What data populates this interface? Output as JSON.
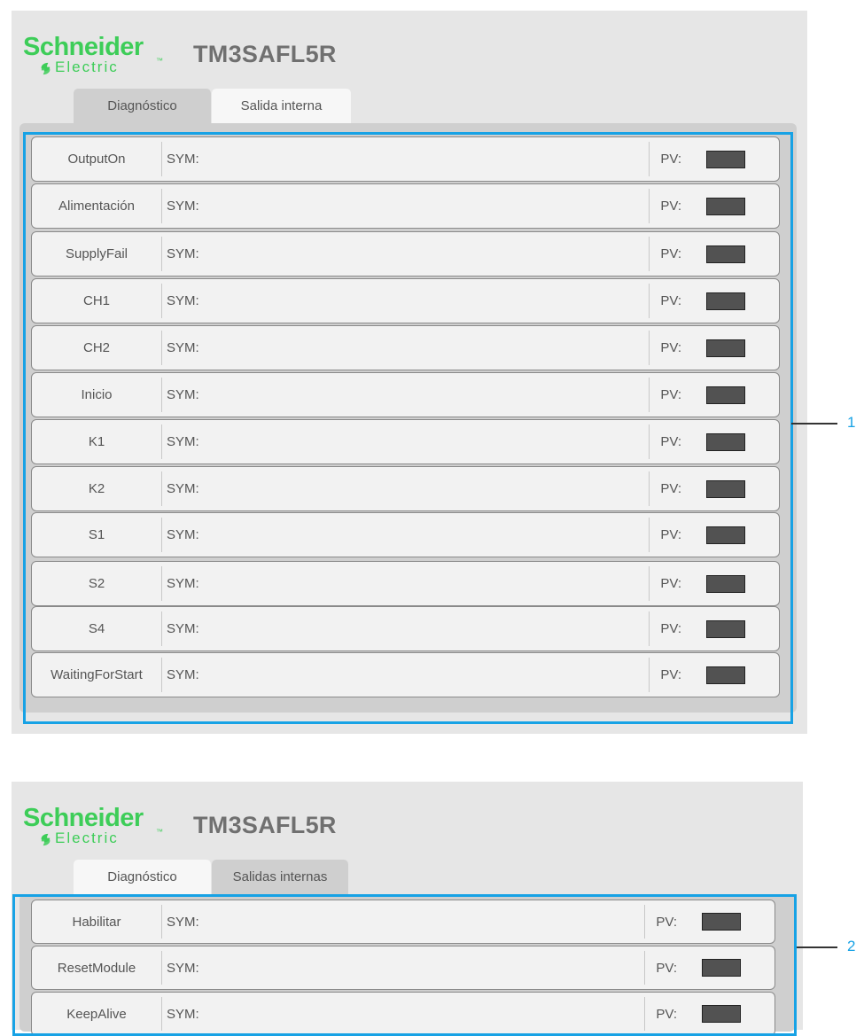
{
  "panel1": {
    "logo_line1": "Schneider",
    "logo_line2": "Electric",
    "model": "TM3SAFL5R",
    "tabs": [
      {
        "label": "Diagnóstico",
        "active": true
      },
      {
        "label": "Salida interna",
        "active": false
      }
    ],
    "sym_label": "SYM:",
    "pv_label": "PV:",
    "rows": [
      "OutputOn",
      "Alimentación",
      "SupplyFail",
      "CH1",
      "CH2",
      "Inicio",
      "K1",
      "K2",
      "S1",
      "S2",
      "S4",
      "WaitingForStart"
    ],
    "callout": "1"
  },
  "panel2": {
    "logo_line1": "Schneider",
    "logo_line2": "Electric",
    "model": "TM3SAFL5R",
    "tabs": [
      {
        "label": "Diagnóstico",
        "active": false
      },
      {
        "label": "Salidas internas",
        "active": true
      }
    ],
    "sym_label": "SYM:",
    "pv_label": "PV:",
    "rows": [
      "Habilitar",
      "ResetModule",
      "KeepAlive"
    ],
    "callout": "2"
  },
  "colors": {
    "brand_green": "#3dcd58",
    "highlight_blue": "#17a2e5",
    "led": "#525252"
  },
  "icons": {
    "brand_mark": "schneider-electric-logo-icon"
  }
}
